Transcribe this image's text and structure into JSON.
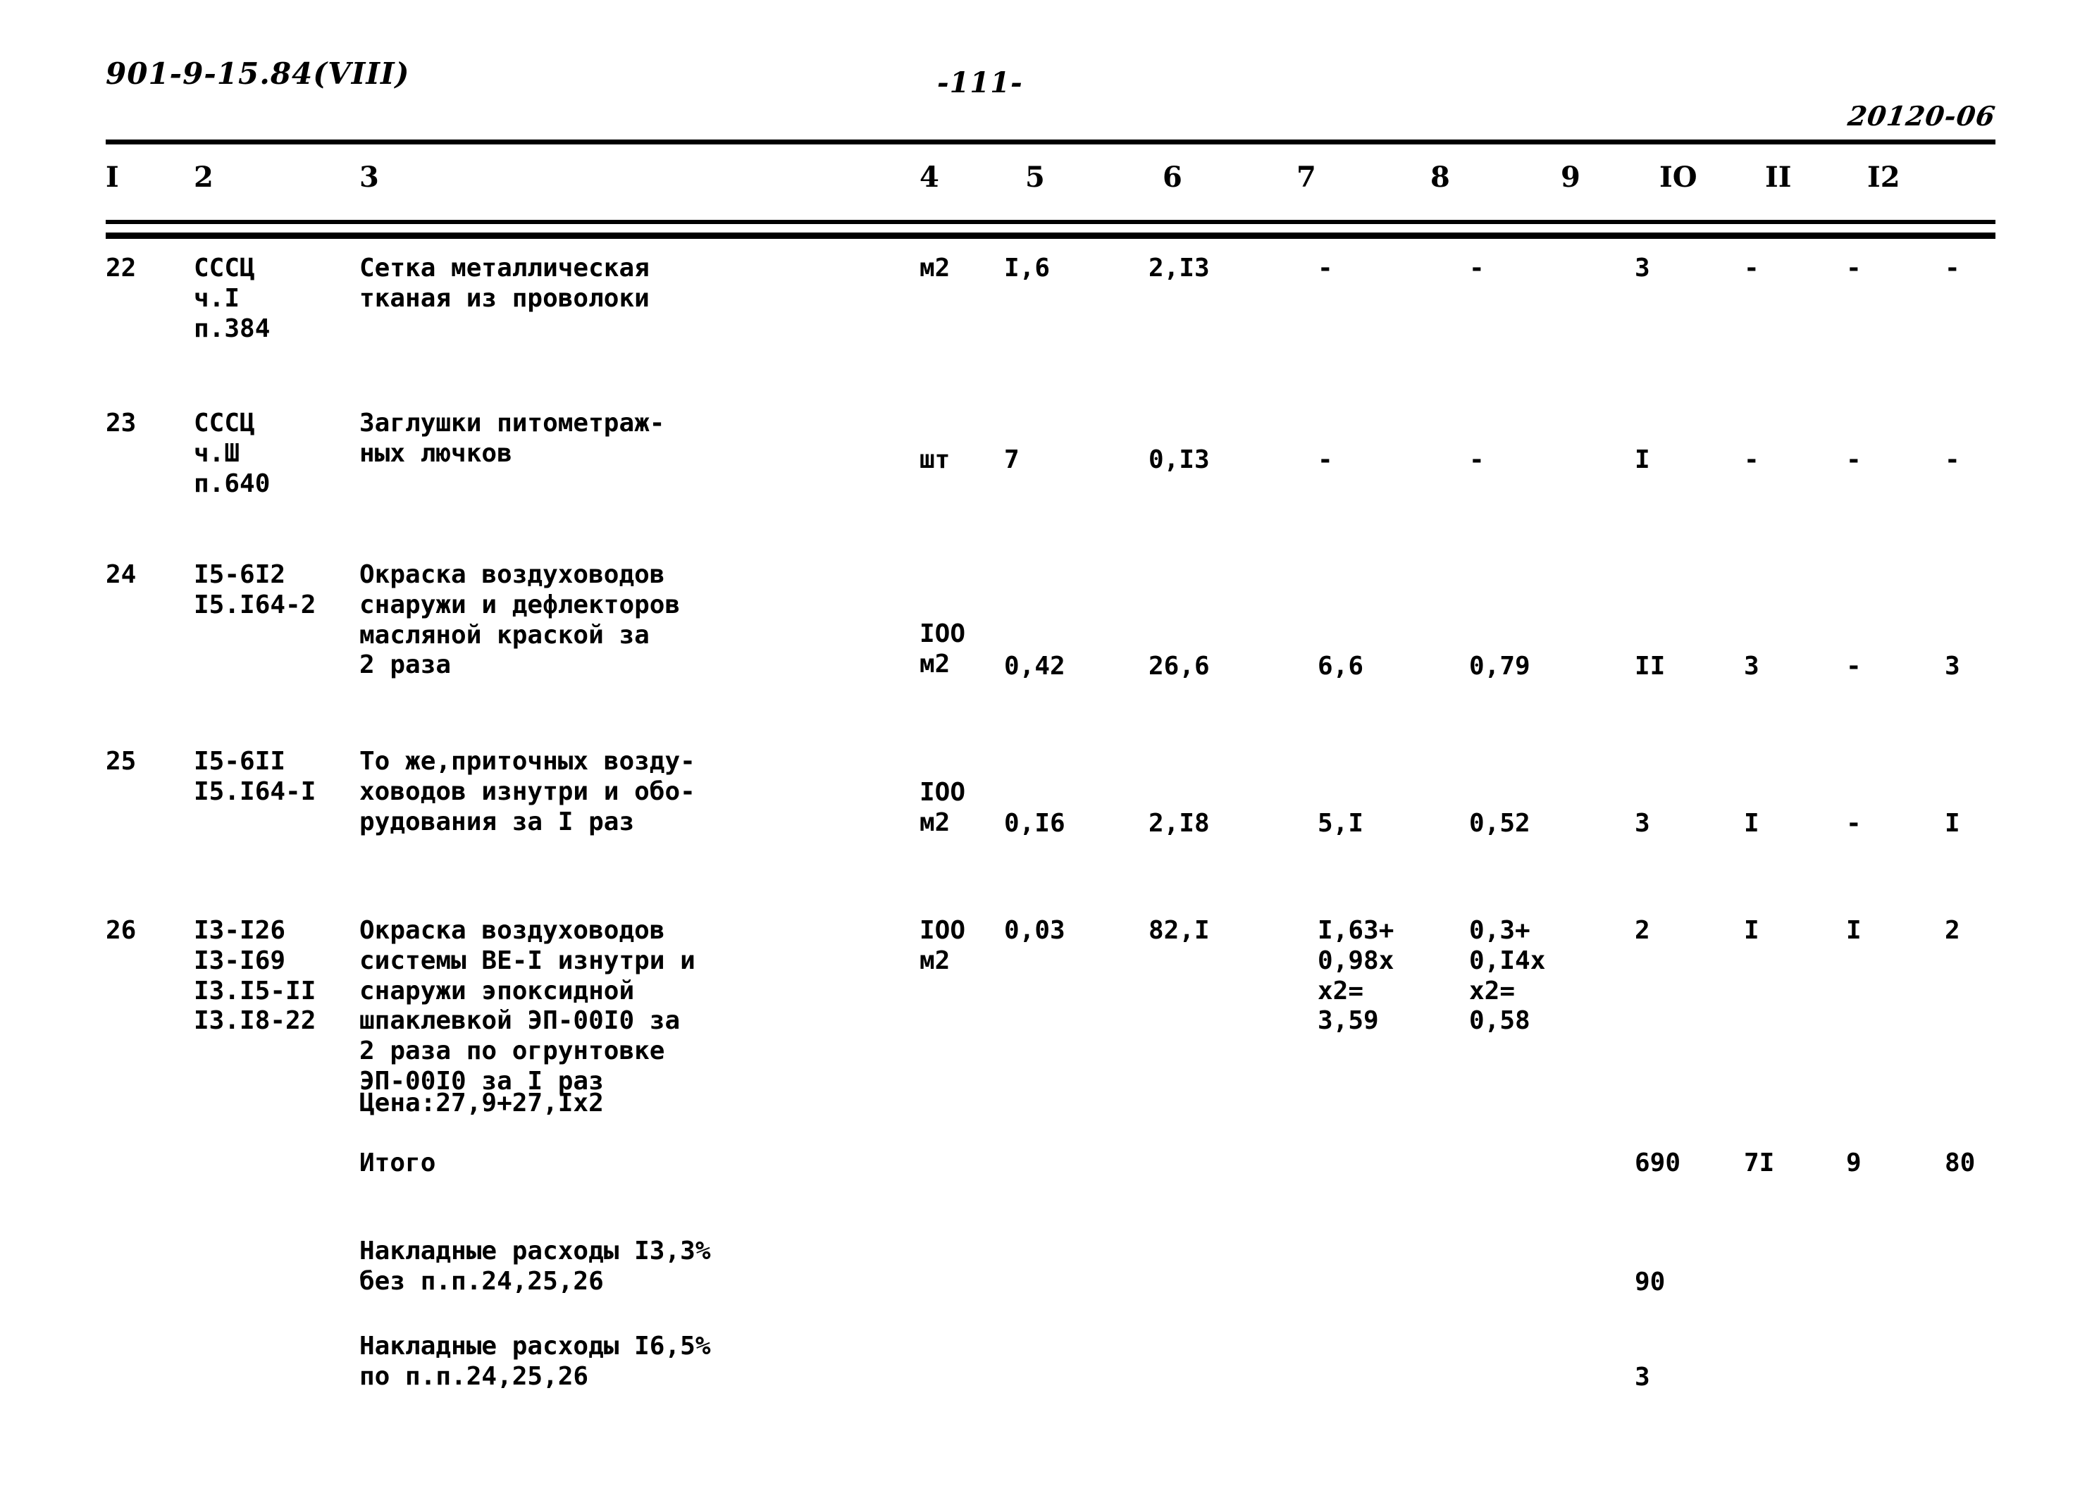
{
  "header": {
    "doc_code": "901-9-15.84(VIII)",
    "page_number": "-111-",
    "stamp_code": "20120-06"
  },
  "table": {
    "column_headers": [
      "I",
      "2",
      "3",
      "4",
      "5",
      "6",
      "7",
      "8",
      "9",
      "IO",
      "II",
      "I2"
    ],
    "rows": [
      {
        "num": "22",
        "code": "СССЦ\nч.I\nп.384",
        "desc": "Сетка металлическая\nтканая из проволоки",
        "unit": "м2",
        "c5": "I,6",
        "c6": "2,I3",
        "c7": "-",
        "c8": "-",
        "c9": "3",
        "c10": "-",
        "c11": "-",
        "c12": "-"
      },
      {
        "num": "23",
        "code": "СССЦ\nч.Ш\nп.640",
        "desc": "Заглушки питометраж-\nных лючков",
        "unit": "шт",
        "c5": "7",
        "c6": "0,I3",
        "c7": "-",
        "c8": "-",
        "c9": "I",
        "c10": "-",
        "c11": "-",
        "c12": "-"
      },
      {
        "num": "24",
        "code": "I5-6I2\nI5.I64-2",
        "desc": "Окраска воздуховодов\nснаружи и дефлекторов\nмасляной краской за\n2 раза",
        "unit": "IOO\nм2",
        "c5": "0,42",
        "c6": "26,6",
        "c7": "6,6",
        "c8": "0,79",
        "c9": "II",
        "c10": "3",
        "c11": "-",
        "c12": "3"
      },
      {
        "num": "25",
        "code": "I5-6II\nI5.I64-I",
        "desc": "То же,приточных возду-\nховодов изнутри и обо-\nрудования за I раз",
        "unit": "IOO\nм2",
        "c5": "0,I6",
        "c6": "2,I8",
        "c7": "5,I",
        "c8": "0,52",
        "c9": "3",
        "c10": "I",
        "c11": "-",
        "c12": "I"
      },
      {
        "num": "26",
        "code": "I3-I26\nI3-I69\nI3.I5-II\nI3.I8-22",
        "desc": "Окраска воздуховодов\nсистемы ВЕ-I изнутри и\nснаружи эпоксидной\nшпаклевкой ЭП-00I0 за\n2 раза по огрунтовке\nЭП-00I0 за I раз",
        "desc_price": "Цена:27,9+27,Iх2",
        "unit": "IOO\nм2",
        "c5": "0,03",
        "c6": "82,I",
        "c7": "I,63+\n0,98х\nх2=\n3,59",
        "c8": "0,3+\n0,I4х\nх2=\n0,58",
        "c9": "2",
        "c10": "I",
        "c11": "I",
        "c12": "2"
      }
    ],
    "summary": [
      {
        "label": "Итого",
        "c9": "690",
        "c10": "7I",
        "c11": "9",
        "c12": "80"
      },
      {
        "label": "Накладные расходы I3,3%\nбез п.п.24,25,26",
        "c9": "90",
        "c10": "",
        "c11": "",
        "c12": ""
      },
      {
        "label": "Накладные расходы I6,5%\nпо п.п.24,25,26",
        "c9": "3",
        "c10": "",
        "c11": "",
        "c12": ""
      }
    ]
  }
}
